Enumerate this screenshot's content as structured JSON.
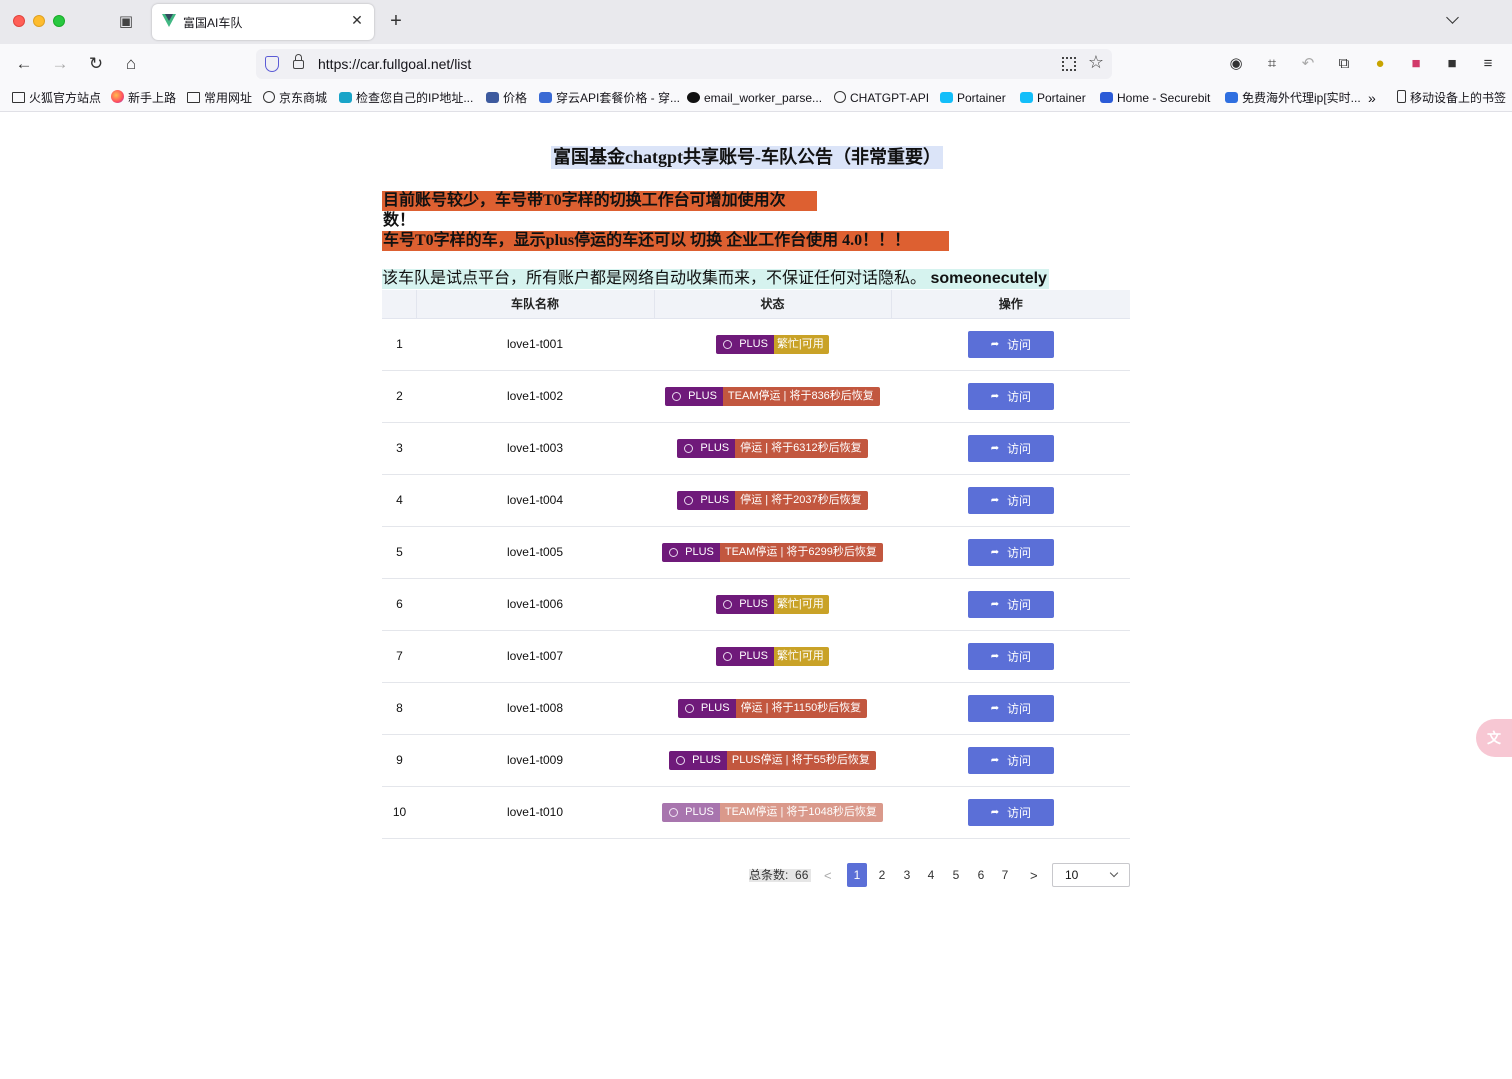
{
  "browser": {
    "tab_title": "富国AI车队",
    "url": "https://car.fullgoal.net/list",
    "bookmarks": [
      {
        "label": "火狐官方站点",
        "icon": "folder-icon"
      },
      {
        "label": "新手上路",
        "icon": "firefox-icon"
      },
      {
        "label": "常用网址",
        "icon": "folder-icon"
      },
      {
        "label": "京东商城",
        "icon": "globe-icon"
      },
      {
        "label": "检查您自己的IP地址...",
        "icon": "ip-check-icon"
      },
      {
        "label": "价格",
        "icon": "price-icon"
      },
      {
        "label": "穿云API套餐价格 - 穿...",
        "icon": "cloud-icon"
      },
      {
        "label": "email_worker_parse...",
        "icon": "github-icon"
      },
      {
        "label": "CHATGPT-API",
        "icon": "globe-icon"
      },
      {
        "label": "Portainer",
        "icon": "portainer-icon"
      },
      {
        "label": "Portainer",
        "icon": "portainer-icon"
      },
      {
        "label": "Home - Securebit",
        "icon": "securebit-icon"
      },
      {
        "label": "免费海外代理ip[实时...",
        "icon": "proxy-icon"
      },
      {
        "label": "移动设备上的书签",
        "icon": "mobile-icon"
      }
    ]
  },
  "header": {
    "title": "富国基金chatgpt共享账号-车队公告（非常重要）",
    "notice1": "目前账号较少，车号带T0字样的切换工作台可增加使用次数！",
    "notice2": "车号T0字样的车，显示plus停运的车还可以 切换 企业工作台使用 4.0！！！",
    "privacy_text": "该车队是试点平台，所有账户都是网络自动收集而来，不保证任何对话隐私。",
    "privacy_name": "someonecutely"
  },
  "table": {
    "columns": [
      "",
      "车队名称",
      "状态",
      "操作"
    ],
    "plus_label": "PLUS",
    "visit_label": "访问",
    "rows": [
      {
        "index": "1",
        "name": "love1-t001",
        "status": "繁忙|可用",
        "kind": "busy"
      },
      {
        "index": "2",
        "name": "love1-t002",
        "status": "TEAM停运 | 将于836秒后恢复",
        "kind": "stop"
      },
      {
        "index": "3",
        "name": "love1-t003",
        "status": "停运 | 将于6312秒后恢复",
        "kind": "stop"
      },
      {
        "index": "4",
        "name": "love1-t004",
        "status": "停运 | 将于2037秒后恢复",
        "kind": "stop"
      },
      {
        "index": "5",
        "name": "love1-t005",
        "status": "TEAM停运 | 将于6299秒后恢复",
        "kind": "stop"
      },
      {
        "index": "6",
        "name": "love1-t006",
        "status": "繁忙|可用",
        "kind": "busy"
      },
      {
        "index": "7",
        "name": "love1-t007",
        "status": "繁忙|可用",
        "kind": "busy"
      },
      {
        "index": "8",
        "name": "love1-t008",
        "status": "停运 | 将于1150秒后恢复",
        "kind": "stop"
      },
      {
        "index": "9",
        "name": "love1-t009",
        "status": "PLUS停运 | 将于55秒后恢复",
        "kind": "stop"
      },
      {
        "index": "10",
        "name": "love1-t010",
        "status": "TEAM停运 | 将于1048秒后恢复",
        "kind": "stop-faded"
      }
    ]
  },
  "pagination": {
    "total_label": "总条数:",
    "total": "66",
    "pages": [
      "1",
      "2",
      "3",
      "4",
      "5",
      "6",
      "7"
    ],
    "current": "1",
    "page_size": "10"
  },
  "colors": {
    "accent": "#5b6fd7",
    "plus": "#6f1a7a",
    "busy": "#c9a227",
    "stop": "#c2573f",
    "notice": "#dd6031"
  }
}
